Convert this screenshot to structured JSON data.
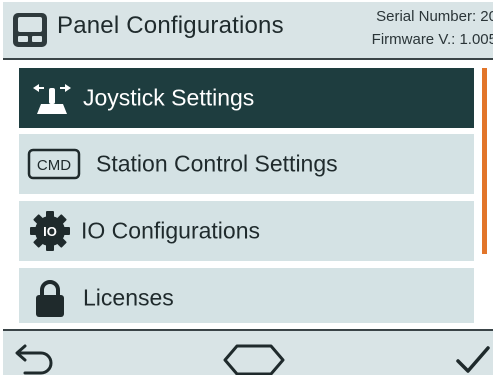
{
  "header": {
    "title": "Panel Configurations",
    "serial_number": "Serial Number: 20",
    "firmware_version": "Firmware V.: 1.005",
    "icon": "panel-device-icon"
  },
  "menu": {
    "items": [
      {
        "label": "Joystick Settings",
        "icon": "joystick-icon",
        "selected": true
      },
      {
        "label": "Station Control Settings",
        "icon": "cmd-icon",
        "icon_text": "CMD",
        "selected": false
      },
      {
        "label": "IO Configurations",
        "icon": "io-gear-icon",
        "icon_text": "IO",
        "selected": false
      },
      {
        "label": "Licenses",
        "icon": "lock-icon",
        "selected": false
      }
    ]
  },
  "footer": {
    "back_icon": "back-arrow-icon",
    "home_icon": "hexagon-home-icon",
    "confirm_icon": "checkmark-icon"
  },
  "colors": {
    "header_bg": "#d9e4e6",
    "item_bg": "#d4e2e4",
    "item_selected_bg": "#1e3d3f",
    "scrollbar": "#e2752a",
    "text_dark": "#1f2a2c"
  }
}
